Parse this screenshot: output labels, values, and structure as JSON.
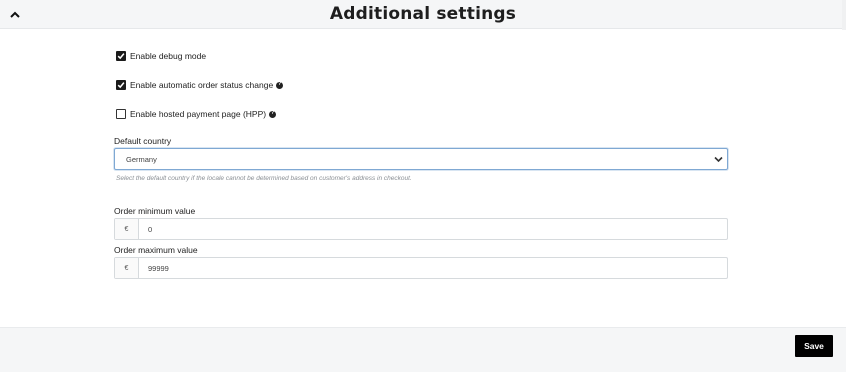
{
  "header": {
    "title": "Additional settings",
    "collapse_icon": "chevron-up-icon"
  },
  "checkboxes": [
    {
      "label": "Enable debug mode",
      "checked": true,
      "help": false
    },
    {
      "label": "Enable automatic order status change",
      "checked": true,
      "help": true
    },
    {
      "label": "Enable hosted payment page (HPP)",
      "checked": false,
      "help": true
    }
  ],
  "default_country": {
    "label": "Default country",
    "selected": "Germany",
    "hint": "Select the default country if the locale cannot be determined based on customer's address in checkout."
  },
  "order_minimum": {
    "label": "Order minimum value",
    "currency": "€",
    "value": "0"
  },
  "order_maximum": {
    "label": "Order maximum value",
    "currency": "€",
    "value": "99999"
  },
  "footer": {
    "save_label": "Save"
  },
  "colors": {
    "accent_border": "#7fa8d3",
    "button_bg": "#000000",
    "header_bg": "#f5f6f7"
  }
}
